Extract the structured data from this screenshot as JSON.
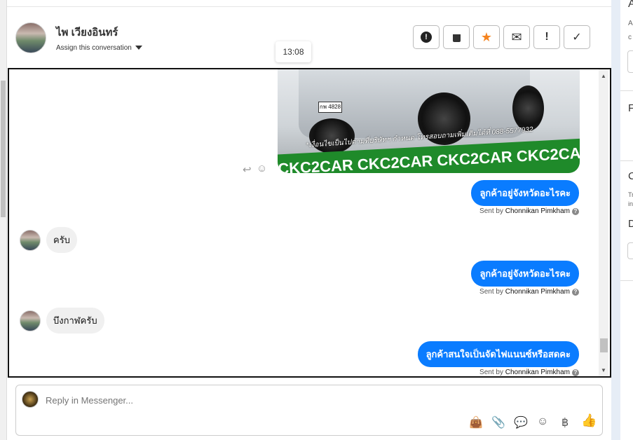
{
  "header": {
    "contact_name": "ไพ เวียงอินทร์",
    "assign_label": "Assign this conversation",
    "tooltip_time": "13:08"
  },
  "toolbar": [
    {
      "name": "spam-button",
      "icon": "alert-circle-icon",
      "glyph": "!"
    },
    {
      "name": "delete-button",
      "icon": "trash-icon",
      "glyph": "🗑"
    },
    {
      "name": "star-button",
      "icon": "star-icon",
      "glyph": "★",
      "color": "#f5841f"
    },
    {
      "name": "mark-unread-button",
      "icon": "envelope-icon",
      "glyph": "✉"
    },
    {
      "name": "follow-up-button",
      "icon": "exclamation-icon",
      "glyph": "!"
    },
    {
      "name": "done-button",
      "icon": "check-icon",
      "glyph": "✓"
    }
  ],
  "image": {
    "caption": "*เงื่อนไขเป็นไปตามที่บริษัทฯ กำหนด โทรสอบถามเพิ่มเติมได้ที่ 088-5577932",
    "banner": "CKC2CAR CKC2CAR CKC2CAR CKC2CAR CKC2",
    "plate": "กพ 4828"
  },
  "messages": [
    {
      "dir": "out",
      "text": "ลูกค้าอยู่จังหวัดอะไรคะ",
      "sent_prefix": "Sent by",
      "sender": "Chonnikan Pimkham"
    },
    {
      "dir": "in",
      "text": "ครับ"
    },
    {
      "dir": "out",
      "text": "ลูกค้าอยู่จังหวัดอะไรคะ",
      "sent_prefix": "Sent by",
      "sender": "Chonnikan Pimkham"
    },
    {
      "dir": "in",
      "text": "บึงกาฬครับ"
    },
    {
      "dir": "out",
      "text": "ลูกค้าสนใจเป็นจัดไฟแนนซ์หรือสดคะ",
      "sent_prefix": "Sent by",
      "sender": "Chonnikan Pimkham"
    }
  ],
  "reply": {
    "placeholder": "Reply in Messenger..."
  },
  "right_panel": {
    "h1": "A",
    "t1": "A",
    "t2": "c",
    "h2": "F",
    "h3": "C",
    "t3": "Tr",
    "t4": "in",
    "h4": "D"
  },
  "colors": {
    "accent": "#0a7cff",
    "star": "#f5841f"
  }
}
